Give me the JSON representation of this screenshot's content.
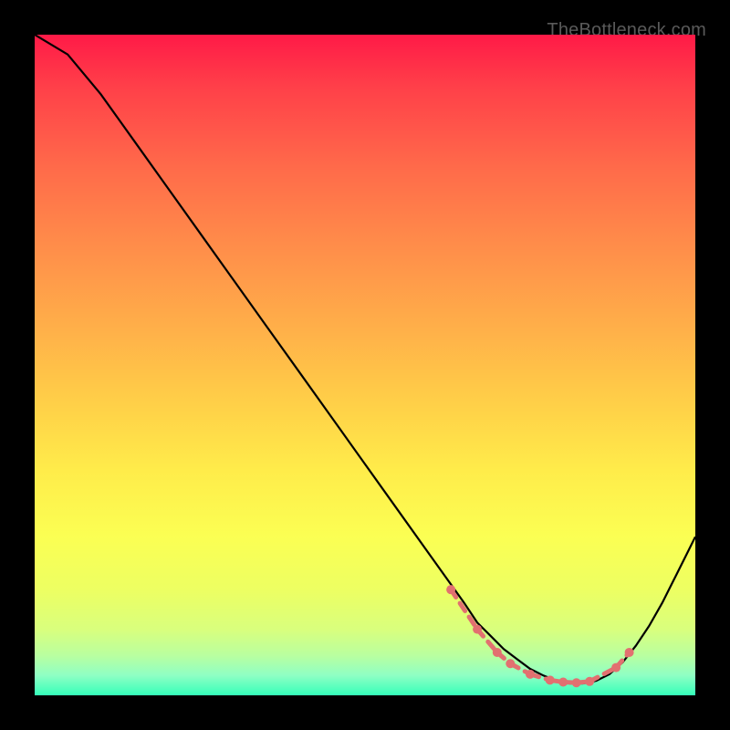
{
  "watermark": "TheBottleneck.com",
  "chart_data": {
    "type": "line",
    "title": "",
    "xlabel": "",
    "ylabel": "",
    "xlim": [
      0,
      100
    ],
    "ylim": [
      0,
      100
    ],
    "x": [
      0,
      5,
      10,
      15,
      20,
      25,
      30,
      35,
      40,
      45,
      50,
      55,
      60,
      65,
      67,
      69,
      71,
      73,
      75,
      77,
      79,
      81,
      83,
      85,
      87,
      89,
      91,
      93,
      95,
      97,
      99,
      100
    ],
    "values": [
      100,
      97,
      91,
      84,
      77,
      70,
      63,
      56,
      49,
      42,
      35,
      28,
      21,
      14,
      11,
      9,
      7,
      5.5,
      4,
      3,
      2.2,
      1.8,
      1.8,
      2.2,
      3.2,
      5,
      7.5,
      10.5,
      14,
      18,
      22,
      24
    ],
    "gradient_stops": [
      {
        "pos": 0.0,
        "color": "#ff1a47"
      },
      {
        "pos": 0.5,
        "color": "#ffc048"
      },
      {
        "pos": 0.8,
        "color": "#f7ff58"
      },
      {
        "pos": 1.0,
        "color": "#35ffb9"
      }
    ],
    "markers": {
      "x": [
        63,
        67,
        70,
        72,
        75,
        78,
        80,
        82,
        84,
        88,
        90
      ],
      "y": [
        16,
        10,
        6.5,
        4.8,
        3.2,
        2.3,
        2.0,
        1.9,
        2.1,
        4.2,
        6.5
      ],
      "color": "#e27070"
    }
  }
}
